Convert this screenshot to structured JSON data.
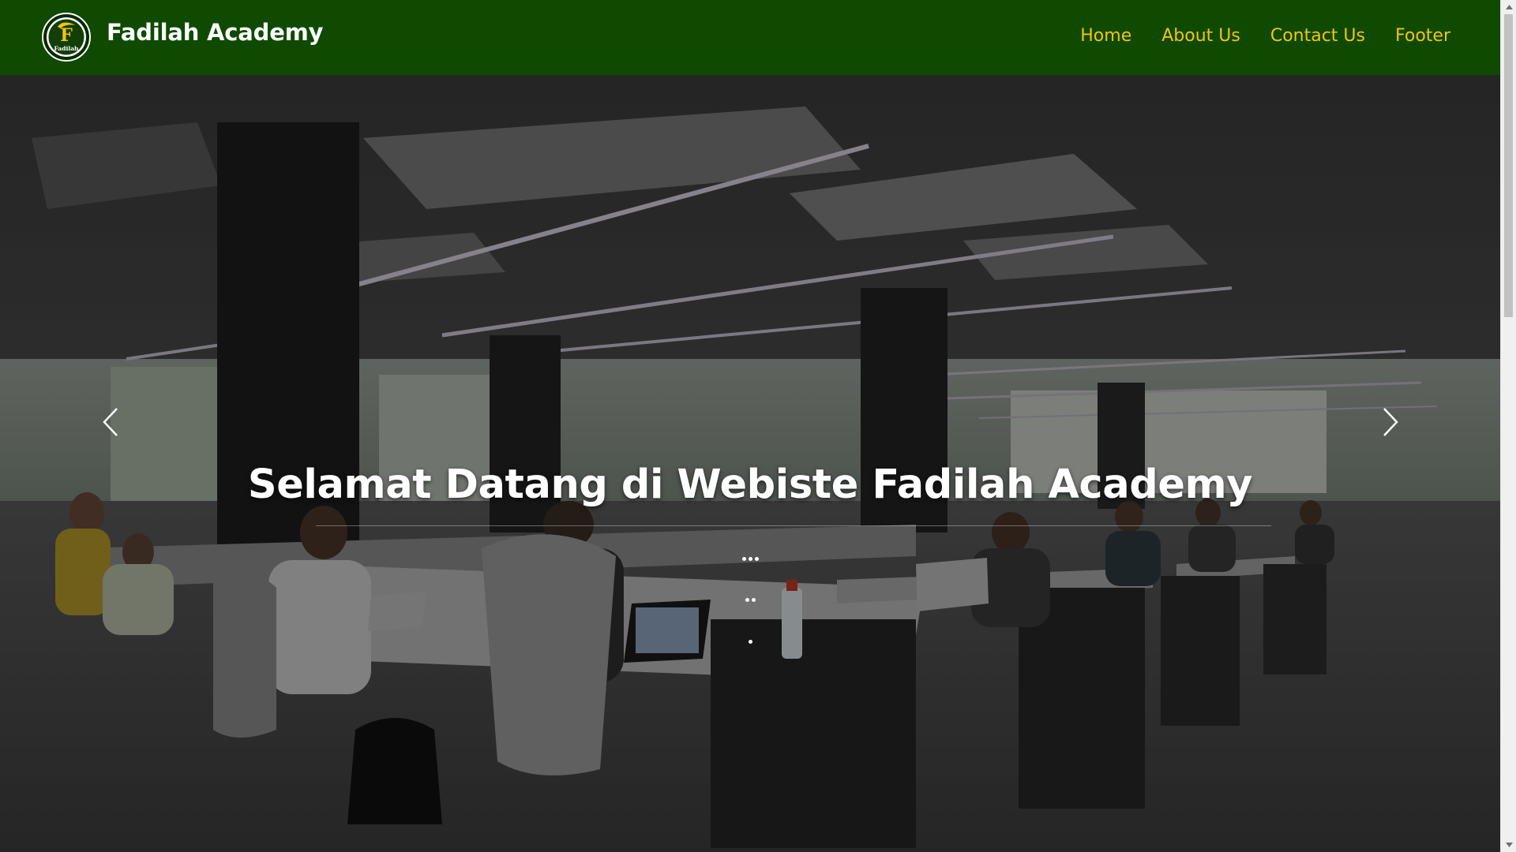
{
  "navbar": {
    "brand": "Fadilah Academy",
    "logo": {
      "letter": "F",
      "caption": "Fadilah",
      "icon": "academy-logo-icon"
    },
    "links": [
      {
        "label": "Home"
      },
      {
        "label": "About Us"
      },
      {
        "label": "Contact Us"
      },
      {
        "label": "Footer"
      }
    ]
  },
  "hero": {
    "caption_title": "Selamat Datang di Webiste Fadilah Academy",
    "background": "office-room-photo",
    "controls": {
      "prev_icon": "chevron-left-icon",
      "next_icon": "chevron-right-icon"
    },
    "indicators": [
      {
        "dots": 3
      },
      {
        "dots": 2
      },
      {
        "dots": 1
      }
    ]
  },
  "colors": {
    "navbar_bg": "#0f4a00",
    "nav_link": "#f1c40f",
    "brand_text": "#ffffff",
    "logo_letter": "#f1c40f"
  }
}
